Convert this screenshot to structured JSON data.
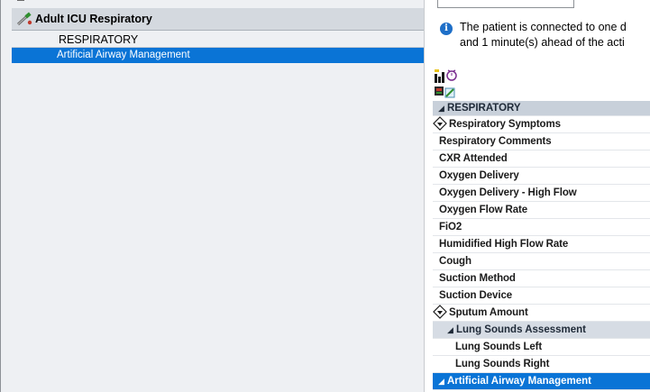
{
  "navigator": {
    "header": "Adult ICU Respiratory",
    "items": [
      {
        "label": "RESPIRATORY",
        "selected": false
      },
      {
        "label": "Artificial Airway Management",
        "selected": true
      }
    ]
  },
  "info_banner": {
    "line1": "The patient is connected to one d",
    "line2": "and 1 minute(s) ahead of the acti"
  },
  "grid": {
    "section": "RESPIRATORY",
    "rows": [
      {
        "label": "Respiratory Symptoms",
        "icon": "diamond-arrow-icon"
      },
      {
        "label": "Respiratory Comments"
      },
      {
        "label": "CXR Attended"
      },
      {
        "label": "Oxygen Delivery"
      },
      {
        "label": "Oxygen Delivery - High Flow"
      },
      {
        "label": "Oxygen Flow Rate"
      },
      {
        "label": "FiO2"
      },
      {
        "label": "Humidified High Flow Rate"
      },
      {
        "label": "Cough"
      },
      {
        "label": "Suction Method"
      },
      {
        "label": "Suction Device"
      },
      {
        "label": "Sputum Amount",
        "icon": "diamond-arrow-icon"
      }
    ],
    "subsection": "Lung Sounds Assessment",
    "sub_rows": [
      {
        "label": "Lung Sounds Left"
      },
      {
        "label": "Lung Sounds Right"
      }
    ],
    "selected_section": "Artificial Airway Management"
  },
  "colors": {
    "selection": "#0a74d6",
    "section_header": "#c8d0da",
    "panel_bg": "#eef0f3",
    "info_icon": "#1e6fc8"
  }
}
